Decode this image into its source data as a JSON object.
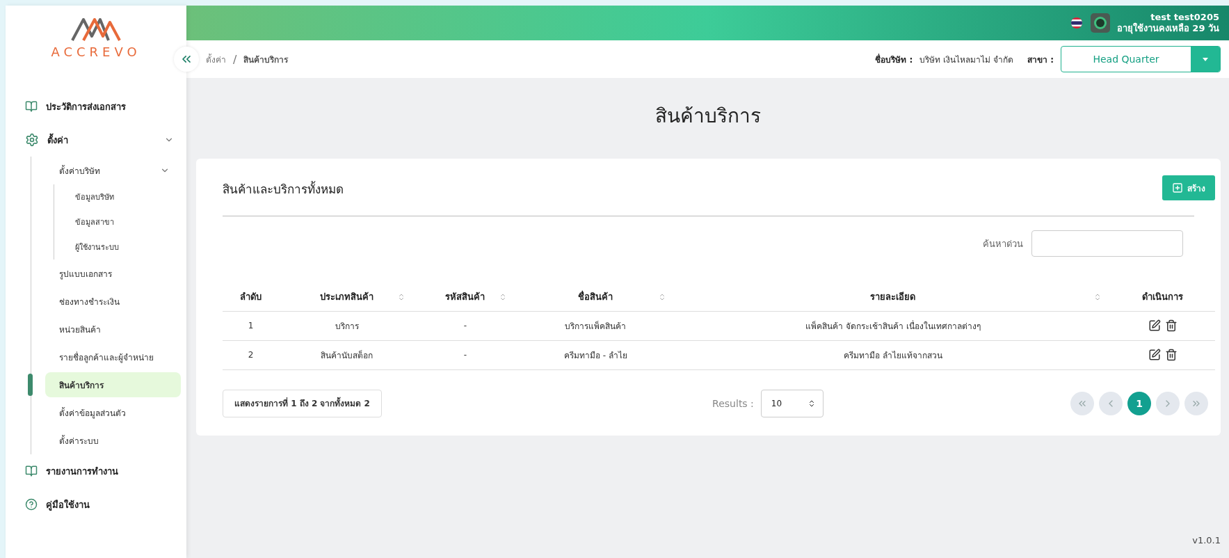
{
  "sidebar": {
    "logo_text": "ACCREVO",
    "items": [
      {
        "kind": "page",
        "label": "ประวัติการส่งเอกสาร",
        "selected": false
      },
      {
        "kind": "group",
        "label": "ตั้งค่า",
        "expanded": true,
        "children": [
          {
            "label": "ตั้งค่าบริษัท",
            "expanded": true,
            "selected": false,
            "children": [
              {
                "label": "ข้อมูลบริษัท",
                "selected": false
              },
              {
                "label": "ข้อมูลสาขา",
                "selected": false
              },
              {
                "label": "ผู้ใช้งานระบบ",
                "selected": false
              }
            ]
          },
          {
            "label": "รูปแบบเอกสาร",
            "selected": false
          },
          {
            "label": "ช่องทางชำระเงิน",
            "selected": false
          },
          {
            "label": "หน่วยสินค้า",
            "selected": false
          },
          {
            "label": "รายชื่อลูกค้าและผู้จำหน่าย",
            "selected": false
          },
          {
            "label": "สินค้าบริการ",
            "selected": true
          },
          {
            "label": "ตั้งค่าข้อมูลส่วนตัว",
            "selected": false
          },
          {
            "label": "ตั้งค่าระบบ",
            "selected": false
          }
        ]
      },
      {
        "kind": "page",
        "label": "รายงานการทำงาน",
        "selected": false
      },
      {
        "kind": "guide",
        "label": "คู่มือใช้งาน",
        "selected": false
      }
    ]
  },
  "header": {
    "user_name": "test test0205",
    "remaining": "อายุใช้งานคงเหลือ 29 วัน"
  },
  "breadcrumb": {
    "items": [
      "ตั้งค่า",
      "สินค้าบริการ"
    ],
    "separator": "/"
  },
  "company": {
    "label": "ชื่อบริษัท :",
    "value": "บริษัท เงินไหลมาไม่ จำกัด"
  },
  "branch": {
    "label": "สาขา :",
    "value": "Head Quarter"
  },
  "page_title": "สินค้าบริการ",
  "card": {
    "title": "สินค้าและบริการทั้งหมด",
    "create_button": "สร้าง",
    "search": {
      "label": "ค้นหาด่วน"
    },
    "table": {
      "columns": [
        {
          "label": "ลำดับ",
          "sortable": false
        },
        {
          "label": "ประเภทสินค้า",
          "sortable": true
        },
        {
          "label": "รหัสสินค้า",
          "sortable": true
        },
        {
          "label": "ชื่อสินค้า",
          "sortable": true
        },
        {
          "label": "รายละเอียด",
          "sortable": true
        },
        {
          "label": "ดำเนินการ",
          "sortable": false
        }
      ],
      "rows": [
        [
          "1",
          "บริการ",
          "-",
          "บริการแพ็คสินค้า",
          "แพ็คสินค้า จัดกระเช้าสินค้า เนื่องในเทศกาลต่างๆ"
        ],
        [
          "2",
          "สินค้านับสต็อก",
          "-",
          "ครีมทามือ - ลำไย",
          "ครีมทามือ ลำไยแท้จากสวน"
        ]
      ]
    },
    "summary": "แสดงรายการที่ 1 ถึง 2 จากทั้งหมด 2",
    "results": {
      "label": "Results :",
      "value": "10"
    },
    "pagination": [
      {
        "kind": "first",
        "selected": false
      },
      {
        "kind": "prev",
        "selected": false
      },
      {
        "kind": "page",
        "label": "1",
        "selected": true
      },
      {
        "kind": "next",
        "selected": false
      },
      {
        "kind": "last",
        "selected": false
      }
    ]
  },
  "version": "v1.0.1"
}
